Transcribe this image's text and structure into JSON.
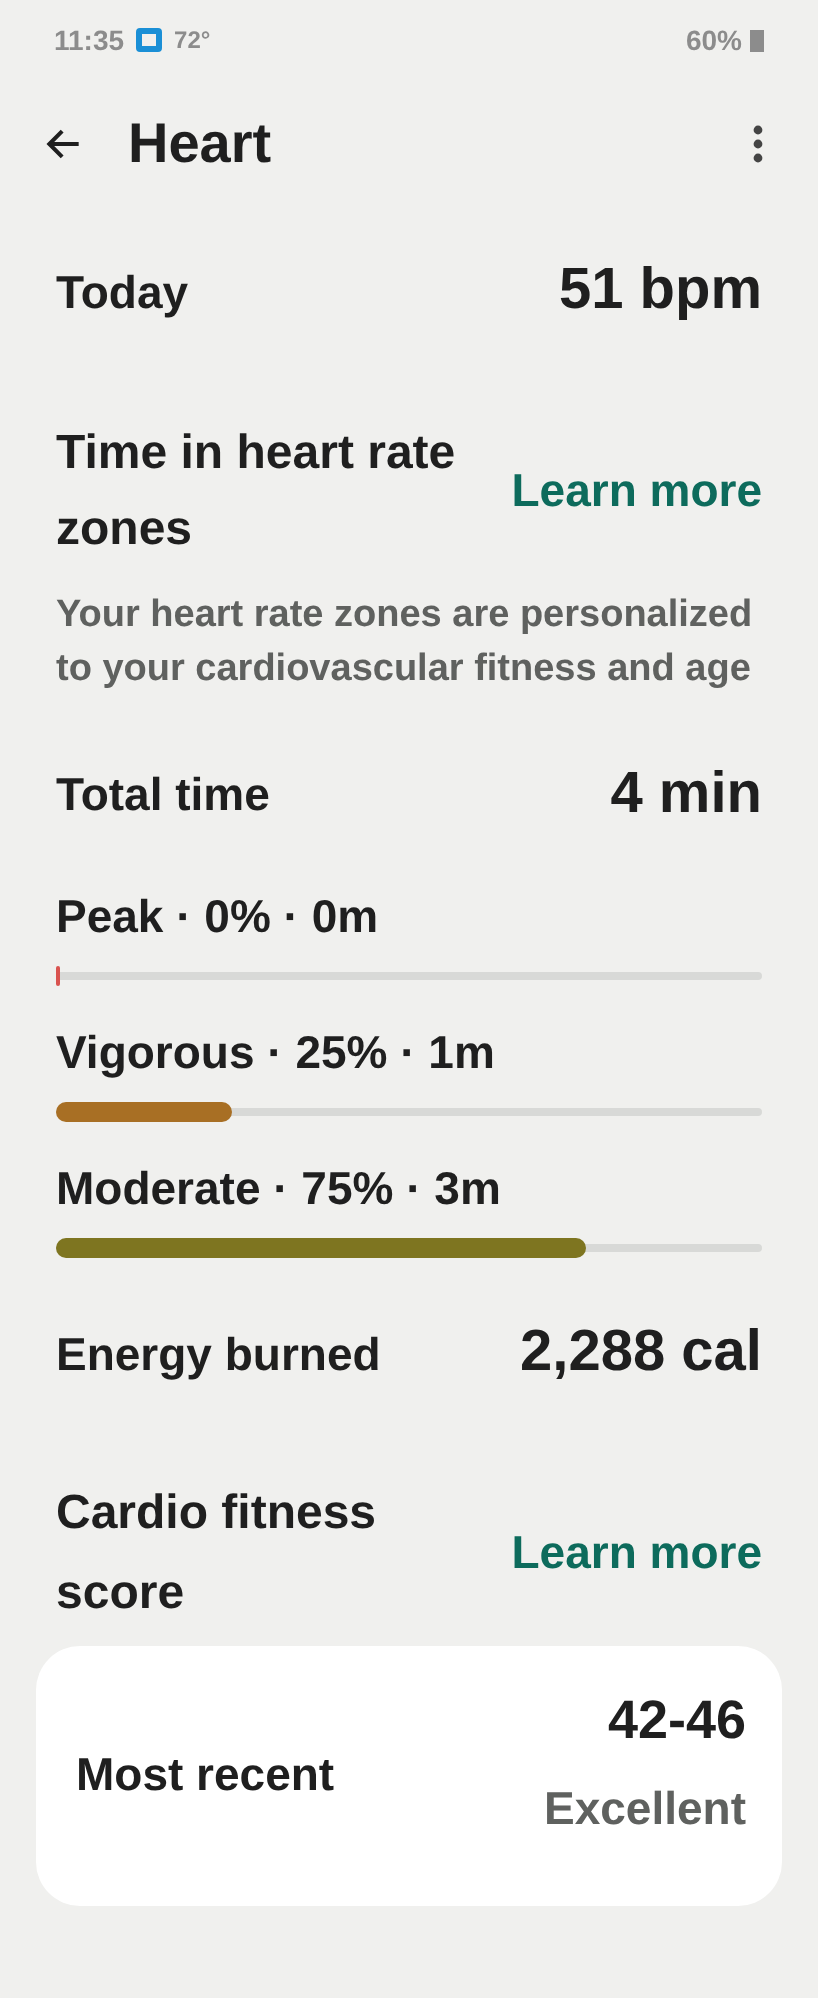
{
  "status_bar": {
    "time": "11:35",
    "temperature": "72°",
    "battery": "60%"
  },
  "header": {
    "title": "Heart"
  },
  "today": {
    "label": "Today",
    "value": "51 bpm"
  },
  "zones": {
    "title": "Time in heart rate zones",
    "link": "Learn more",
    "description": "Your heart rate zones are personalized to your cardiovascular fitness and age"
  },
  "total": {
    "label": "Total time",
    "value": "4 min"
  },
  "zone_bars": [
    {
      "label": "Peak · 0% · 0m",
      "level": 0,
      "color": "#d9534f"
    },
    {
      "label": "Vigorous · 25% · 1m",
      "level": 0.25,
      "color": "#a86f24"
    },
    {
      "label": "Moderate · 75% · 3m",
      "level": 0.75,
      "color": "#7e7520"
    }
  ],
  "energy": {
    "label": "Energy burned",
    "value": "2,288 cal"
  },
  "cardio": {
    "title": "Cardio fitness score",
    "link": "Learn more"
  },
  "recent": {
    "label": "Most recent",
    "value": "42-46",
    "rating": "Excellent"
  }
}
